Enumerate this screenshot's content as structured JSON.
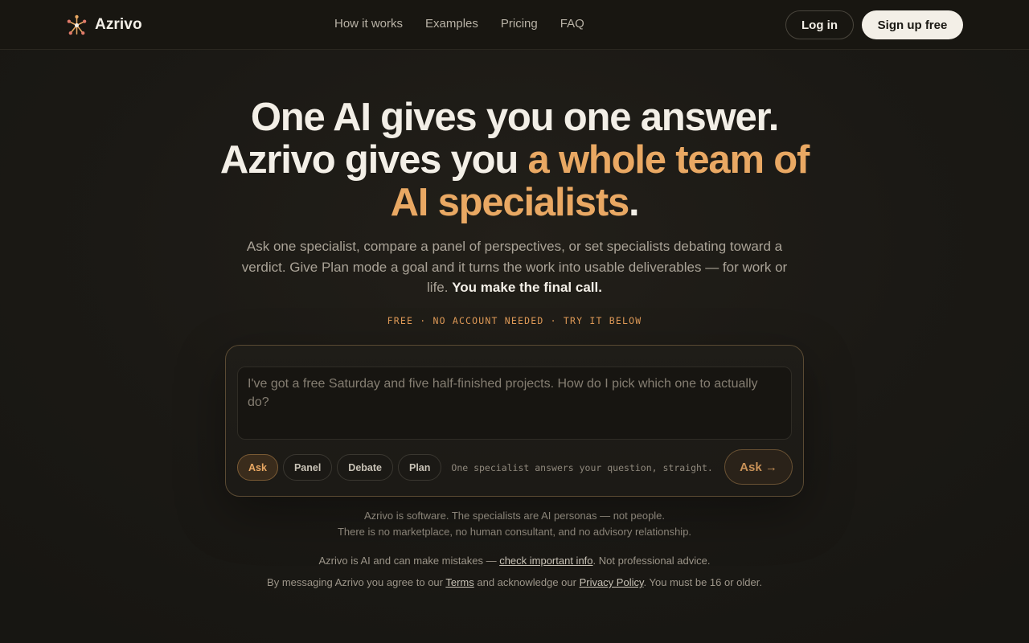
{
  "nav": {
    "brand": "Azrivo",
    "links": [
      "How it works",
      "Examples",
      "Pricing",
      "FAQ"
    ],
    "login": "Log in",
    "signup": "Sign up free"
  },
  "hero": {
    "title_line1": "One AI gives you one answer.",
    "title_line2_a": "Azrivo gives you ",
    "title_line2_accent": "a whole team of",
    "title_line3_accent": "AI specialists",
    "title_line3_end": ".",
    "subtitle": "Ask one specialist, compare a panel of perspectives, or set specialists debating toward a verdict. Give Plan mode a goal and it turns the work into usable deliverables — for work or life.",
    "subtitle_strong": "You make the final call.",
    "tagline": "FREE · NO ACCOUNT NEEDED · TRY IT BELOW"
  },
  "composer": {
    "placeholder": "I've got a free Saturday and five half-finished projects. How do I pick which one to actually do?",
    "modes": [
      "Ask",
      "Panel",
      "Debate",
      "Plan"
    ],
    "active_mode": "Ask",
    "mode_description": "One specialist answers your question, straight.",
    "submit": "Ask →"
  },
  "disclaimer": {
    "line1": "Azrivo is software. The specialists are AI personas — not people.",
    "line2": "There is no marketplace, no human consultant, and no advisory relationship."
  },
  "legal": {
    "mistakes_pre": "Azrivo is AI and can make mistakes — ",
    "mistakes_link": "check important info",
    "mistakes_post": ". Not professional advice.",
    "agree_pre": "By messaging Azrivo you agree to our ",
    "terms": "Terms",
    "agree_mid": " and acknowledge our ",
    "privacy": "Privacy Policy",
    "agree_post": ". You must be 16 or older."
  },
  "colors": {
    "accent": "#e9a863",
    "background": "#1a1813",
    "text": "#f3efe7"
  }
}
